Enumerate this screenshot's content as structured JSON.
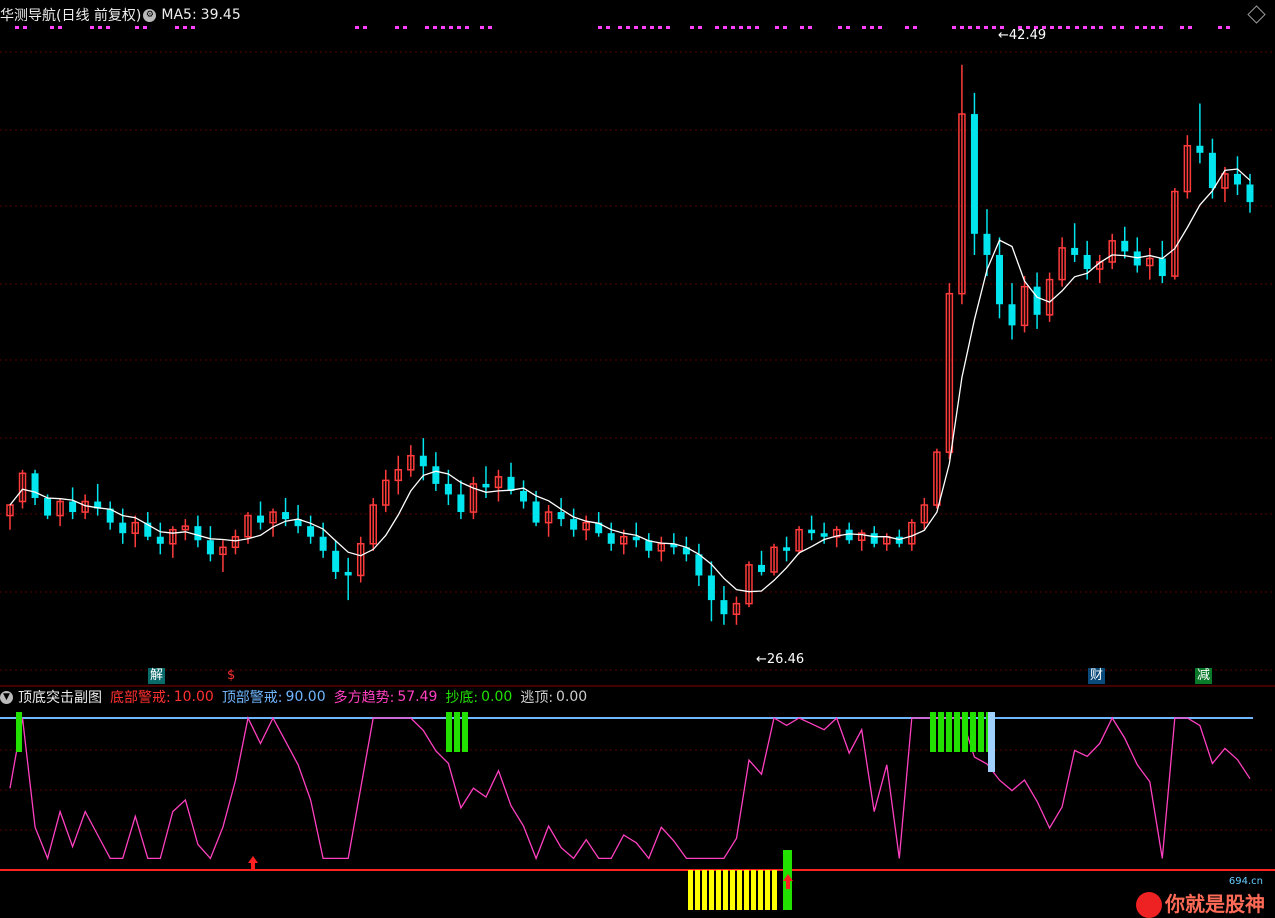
{
  "main_header": {
    "title": "华测导航(日线 前复权)",
    "ma_label": "MA5:",
    "ma_value": "39.45"
  },
  "indicator_header": {
    "name": "顶底突击副图",
    "items": [
      {
        "label": "底部警戒:",
        "value": "10.00",
        "color": "#ff3030"
      },
      {
        "label": "顶部警戒:",
        "value": "90.00",
        "color": "#6fb6ff"
      },
      {
        "label": "多方趋势:",
        "value": "57.49",
        "color": "#ff40c0"
      },
      {
        "label": "抄底:",
        "value": "0.00",
        "color": "#22e000"
      },
      {
        "label": "逃顶:",
        "value": "0.00",
        "color": "#cccccc"
      }
    ]
  },
  "price_labels": {
    "high": "42.49",
    "low": "26.46"
  },
  "event_tags": [
    {
      "text": "解",
      "bg": "#0a6a6a",
      "color": "#ffffff"
    },
    {
      "text": "$",
      "bg": "transparent",
      "color": "#ff3030"
    },
    {
      "text": "财",
      "bg": "#0a4a7a",
      "color": "#ffffff"
    },
    {
      "text": "减",
      "bg": "#0a7a2a",
      "color": "#ffffff"
    }
  ],
  "watermark": {
    "text": "你就是股神",
    "site": "694.cn"
  },
  "colors": {
    "up": "#ff3b3b",
    "down": "#00e5ee",
    "ma": "#ffffff",
    "grid": "#5a0000",
    "top_line": "#6fb6ff",
    "bottom_line": "#ff2020",
    "trend": "#ff40c0",
    "green_bar": "#22e000",
    "yellow_bar": "#ffff00",
    "marker": "#ff40ff"
  },
  "chart_data": {
    "type": "candlestick",
    "series_name": "华测导航",
    "y_range": [
      25.5,
      43.5
    ],
    "candles": [
      [
        29.6,
        29.9,
        29.2,
        29.9
      ],
      [
        30.0,
        30.9,
        29.8,
        30.8
      ],
      [
        30.8,
        30.9,
        29.9,
        30.1
      ],
      [
        30.1,
        30.2,
        29.5,
        29.6
      ],
      [
        29.6,
        30.1,
        29.3,
        30.0
      ],
      [
        30.0,
        30.4,
        29.5,
        29.7
      ],
      [
        29.7,
        30.2,
        29.5,
        30.0
      ],
      [
        30.0,
        30.5,
        29.6,
        29.8
      ],
      [
        29.8,
        30.0,
        29.2,
        29.4
      ],
      [
        29.4,
        29.8,
        28.8,
        29.1
      ],
      [
        29.1,
        29.6,
        28.7,
        29.4
      ],
      [
        29.4,
        29.7,
        28.9,
        29.0
      ],
      [
        29.0,
        29.4,
        28.5,
        28.8
      ],
      [
        28.8,
        29.3,
        28.4,
        29.2
      ],
      [
        29.2,
        29.5,
        28.9,
        29.3
      ],
      [
        29.3,
        29.6,
        28.7,
        28.9
      ],
      [
        28.9,
        29.3,
        28.3,
        28.5
      ],
      [
        28.5,
        28.9,
        28.0,
        28.7
      ],
      [
        28.7,
        29.2,
        28.5,
        29.0
      ],
      [
        29.0,
        29.7,
        28.8,
        29.6
      ],
      [
        29.6,
        30.0,
        29.2,
        29.4
      ],
      [
        29.4,
        29.8,
        29.0,
        29.7
      ],
      [
        29.7,
        30.1,
        29.3,
        29.5
      ],
      [
        29.5,
        29.9,
        29.1,
        29.3
      ],
      [
        29.3,
        29.6,
        28.8,
        29.0
      ],
      [
        29.0,
        29.4,
        28.4,
        28.6
      ],
      [
        28.6,
        28.9,
        27.8,
        28.0
      ],
      [
        28.0,
        28.4,
        27.2,
        27.9
      ],
      [
        27.9,
        29.0,
        27.7,
        28.8
      ],
      [
        28.8,
        30.1,
        28.6,
        29.9
      ],
      [
        29.9,
        30.9,
        29.7,
        30.6
      ],
      [
        30.6,
        31.3,
        30.2,
        30.9
      ],
      [
        30.9,
        31.6,
        30.7,
        31.3
      ],
      [
        31.3,
        31.8,
        30.6,
        31.0
      ],
      [
        31.0,
        31.4,
        30.3,
        30.5
      ],
      [
        30.5,
        30.9,
        29.9,
        30.2
      ],
      [
        30.2,
        30.6,
        29.5,
        29.7
      ],
      [
        29.7,
        30.7,
        29.5,
        30.5
      ],
      [
        30.5,
        31.0,
        30.1,
        30.4
      ],
      [
        30.4,
        30.9,
        30.0,
        30.7
      ],
      [
        30.7,
        31.1,
        30.2,
        30.3
      ],
      [
        30.3,
        30.6,
        29.8,
        30.0
      ],
      [
        30.0,
        30.3,
        29.3,
        29.4
      ],
      [
        29.4,
        29.9,
        29.0,
        29.7
      ],
      [
        29.7,
        30.1,
        29.3,
        29.5
      ],
      [
        29.5,
        29.8,
        29.0,
        29.2
      ],
      [
        29.2,
        29.6,
        28.9,
        29.4
      ],
      [
        29.4,
        29.7,
        29.0,
        29.1
      ],
      [
        29.1,
        29.4,
        28.6,
        28.8
      ],
      [
        28.8,
        29.2,
        28.5,
        29.0
      ],
      [
        29.0,
        29.4,
        28.7,
        28.9
      ],
      [
        28.9,
        29.1,
        28.4,
        28.6
      ],
      [
        28.6,
        29.0,
        28.3,
        28.8
      ],
      [
        28.8,
        29.1,
        28.5,
        28.7
      ],
      [
        28.7,
        29.0,
        28.3,
        28.5
      ],
      [
        28.5,
        28.8,
        27.6,
        27.9
      ],
      [
        27.9,
        28.3,
        26.6,
        27.2
      ],
      [
        27.2,
        27.6,
        26.5,
        26.8
      ],
      [
        26.8,
        27.3,
        26.5,
        27.1
      ],
      [
        27.1,
        28.3,
        27.0,
        28.2
      ],
      [
        28.2,
        28.6,
        27.9,
        28.0
      ],
      [
        28.0,
        28.8,
        27.9,
        28.7
      ],
      [
        28.7,
        29.0,
        28.3,
        28.6
      ],
      [
        28.6,
        29.3,
        28.5,
        29.2
      ],
      [
        29.2,
        29.6,
        28.9,
        29.1
      ],
      [
        29.1,
        29.4,
        28.8,
        29.0
      ],
      [
        29.0,
        29.3,
        28.7,
        29.2
      ],
      [
        29.2,
        29.4,
        28.8,
        28.9
      ],
      [
        28.9,
        29.2,
        28.6,
        29.1
      ],
      [
        29.1,
        29.3,
        28.7,
        28.8
      ],
      [
        28.8,
        29.1,
        28.6,
        29.0
      ],
      [
        29.0,
        29.2,
        28.7,
        28.8
      ],
      [
        28.8,
        29.5,
        28.6,
        29.4
      ],
      [
        29.4,
        30.1,
        29.2,
        29.9
      ],
      [
        29.9,
        31.5,
        29.8,
        31.4
      ],
      [
        31.4,
        36.2,
        31.2,
        35.9
      ],
      [
        35.9,
        42.4,
        35.6,
        41.0
      ],
      [
        41.0,
        41.6,
        37.0,
        37.6
      ],
      [
        37.6,
        38.3,
        36.4,
        37.0
      ],
      [
        37.0,
        37.5,
        35.2,
        35.6
      ],
      [
        35.6,
        36.2,
        34.6,
        35.0
      ],
      [
        35.0,
        36.4,
        34.8,
        36.1
      ],
      [
        36.1,
        36.5,
        34.9,
        35.3
      ],
      [
        35.3,
        36.5,
        35.1,
        36.3
      ],
      [
        36.3,
        37.5,
        36.1,
        37.2
      ],
      [
        37.2,
        37.9,
        36.8,
        37.0
      ],
      [
        37.0,
        37.4,
        36.3,
        36.6
      ],
      [
        36.6,
        37.0,
        36.2,
        36.8
      ],
      [
        36.8,
        37.6,
        36.6,
        37.4
      ],
      [
        37.4,
        37.8,
        36.9,
        37.1
      ],
      [
        37.1,
        37.5,
        36.5,
        36.7
      ],
      [
        36.7,
        37.2,
        36.3,
        36.9
      ],
      [
        36.9,
        37.4,
        36.2,
        36.4
      ],
      [
        36.4,
        38.9,
        36.3,
        38.8
      ],
      [
        38.8,
        40.4,
        38.6,
        40.1
      ],
      [
        40.1,
        41.3,
        39.6,
        39.9
      ],
      [
        39.9,
        40.3,
        38.6,
        38.9
      ],
      [
        38.9,
        39.5,
        38.5,
        39.3
      ],
      [
        39.3,
        39.8,
        38.7,
        39.0
      ],
      [
        39.0,
        39.3,
        38.2,
        38.5
      ]
    ],
    "ma5_period": 5,
    "ma5_last": 39.45,
    "indicator": {
      "bottom_alert": 10.0,
      "top_alert": 90.0,
      "trend_last": 57.49,
      "bottom_signal": 0.0,
      "top_signal": 0.0,
      "range": [
        0,
        100
      ]
    }
  }
}
